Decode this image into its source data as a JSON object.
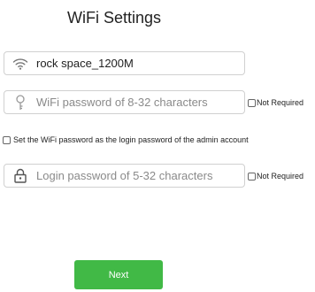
{
  "page": {
    "title": "WiFi Settings"
  },
  "wifi_name": {
    "value": "rock space_1200M",
    "icon": "wifi-icon"
  },
  "wifi_password": {
    "placeholder": "WiFi password of 8-32 characters",
    "icon": "key-icon",
    "not_required_label": "Not Required"
  },
  "same_password_option": {
    "label": "Set the WiFi password as the login password of the admin account"
  },
  "login_password": {
    "placeholder": "Login password of 5-32 characters",
    "icon": "lock-icon",
    "not_required_label": "Not Required"
  },
  "actions": {
    "next_label": "Next"
  },
  "colors": {
    "primary_button": "#41b946",
    "input_border": "#d0d0d0",
    "placeholder": "#8a8a8a"
  }
}
